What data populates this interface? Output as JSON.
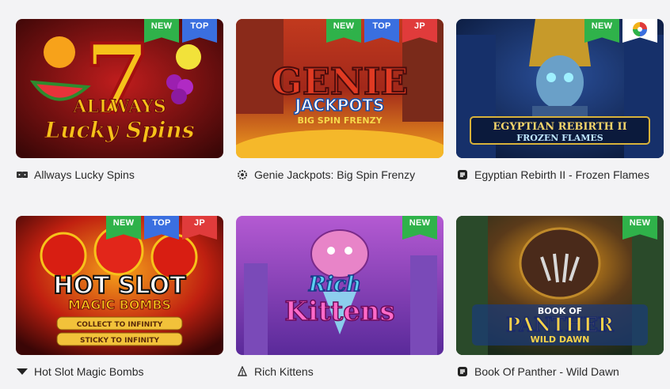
{
  "games": [
    {
      "title": "Allways Lucky Spins",
      "art_title": "ALLWAYS",
      "art_sub": "Lucky Spins",
      "badges": [
        "NEW",
        "TOP"
      ],
      "provider_icon": "provider-dice-icon"
    },
    {
      "title": "Genie Jackpots: Big Spin Frenzy",
      "art_title": "GENIE",
      "art_sub": "JACKPOTS",
      "art_sub2": "BIG SPIN FRENZY",
      "badges": [
        "NEW",
        "TOP",
        "JP"
      ],
      "provider_icon": "provider-gear-icon"
    },
    {
      "title": "Egyptian Rebirth II - Frozen Flames",
      "art_title": "EGYPTIAN REBIRTH II",
      "art_sub": "FROZEN FLAMES",
      "badges": [
        "NEW"
      ],
      "provider_icon": "provider-s-icon"
    },
    {
      "title": "Hot Slot Magic Bombs",
      "art_title": "HOT SLOT",
      "art_sub": "MAGIC BOMBS",
      "art_sub2": "COLLECT TO INFINITY",
      "art_sub3": "STICKY TO INFINITY",
      "badges": [
        "NEW",
        "TOP",
        "JP"
      ],
      "provider_icon": "provider-chevron-icon"
    },
    {
      "title": "Rich Kittens",
      "art_title": "Rich",
      "art_sub": "Kittens",
      "badges": [
        "NEW"
      ],
      "provider_icon": "provider-tree-icon"
    },
    {
      "title": "Book Of Panther - Wild Dawn",
      "art_title": "BOOK OF",
      "art_sub": "PANTHER",
      "art_sub2": "WILD DAWN",
      "badges": [
        "NEW"
      ],
      "provider_icon": "provider-s-icon"
    }
  ],
  "colors": {
    "new": "#2fb24a",
    "top": "#3a6fe0",
    "jp": "#e03b3b"
  }
}
